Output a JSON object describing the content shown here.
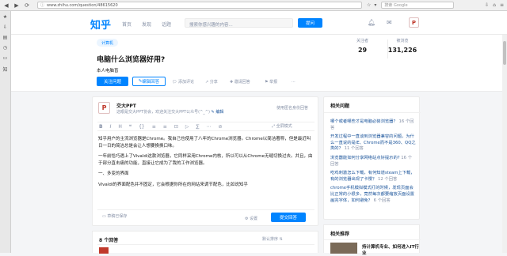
{
  "browser": {
    "url": "www.zhihu.com/question/48615620",
    "search_placeholder": "搜索 Google"
  },
  "header": {
    "logo": "知乎",
    "nav": [
      "首页",
      "发现",
      "话题"
    ],
    "search_placeholder": "搜索你感兴趣的内容...",
    "ask_label": "提问"
  },
  "question": {
    "topic": "计算机",
    "title": "电脑什么浏览器好用?",
    "detail": "本人电脑盲",
    "follow_label": "关注问题",
    "write_label": "编辑回答",
    "actions": [
      "添加评论",
      "分享",
      "邀请回答",
      "举报",
      "..."
    ],
    "stats": {
      "followers_label": "关注者",
      "followers": "29",
      "views_label": "被浏览",
      "views": "131,226"
    }
  },
  "editor": {
    "author": "交大PPT",
    "bio": "这眼是交大PPT协会，欢迎关注交大PPT公众号(^_^)",
    "edit_bio": "编辑",
    "anonymous": "使用匿名身份回答",
    "toolbar": [
      "B",
      "I",
      "H",
      "❝",
      "{}",
      "≡",
      "≡",
      "⊡",
      "▷",
      "∑",
      "⋯",
      "⊘"
    ],
    "fullscreen": "全屏模式",
    "paragraphs": [
      "知乎用户的主流浏览器是Chrome。我自己也使用了八年的Chrome浏览器。Chrome以简洁著称，但是最近叫日一日的简洁总是会让人想要换换口味。",
      "一年前恰巧遇上了Vivaldi这款浏览器，它同样采用Chrome内核，所以可以从Chrome无缝切换过去。并且，由于部分直击痛的功能，直接让它成为了我的工作浏览器。",
      "一、多变的界面",
      "Vivaldi的界面配色并不固定，它会根据你所在的网站来调节配色，比如说知乎"
    ],
    "settings_label": "草稿已保存",
    "cfg_label": "设置",
    "submit_label": "提交回答"
  },
  "answers": {
    "count_label": "8 个回答",
    "sort_label": "默认排序 ⇅"
  },
  "related": {
    "title": "相关问题",
    "items": [
      {
        "q": "哪个或者哪些才是电脑必装浏览器？",
        "meta": "16 个回答"
      },
      {
        "q": "开发过程中一直谈到浏览器兼容的问题，为什么一直说的是IE、Chrome而不是360、QQ之类的？",
        "meta": "11 个回答"
      },
      {
        "q": "浏览器能如何分享网络站点好提示的?",
        "meta": "16 个回答"
      },
      {
        "q": "吃鸡刺激怎么下载，有何知道steam上下载，有的浏览器出现了卡慢？",
        "meta": "12 个回答"
      },
      {
        "q": "chrome手机模拟模式打的时候，发现页面会比正常的小很多，竟然每次都要缩放页面设置画完字体，如何避免？",
        "meta": "6 个回答"
      }
    ]
  },
  "recommend": {
    "title": "相关推荐",
    "item": "持计算机专业、如何进入IT行业"
  }
}
